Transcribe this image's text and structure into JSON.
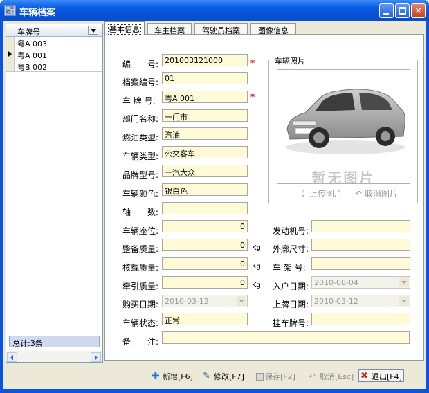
{
  "window": {
    "title": "车辆档案",
    "icon_text": "企业 解决",
    "controls": {
      "minimize": "minimize-icon",
      "maximize": "maximize-icon",
      "close": "×"
    }
  },
  "left_grid": {
    "column_header": "车牌号",
    "rows": [
      {
        "plate": "粤A 003",
        "current": false
      },
      {
        "plate": "粤A 001",
        "current": true
      },
      {
        "plate": "粤B 002",
        "current": false
      }
    ],
    "total": "总计:3条"
  },
  "tabs": [
    {
      "label": "基本信息",
      "active": true
    },
    {
      "label": "车主档案",
      "active": false
    },
    {
      "label": "驾驶员档案",
      "active": false
    },
    {
      "label": "图像信息",
      "active": false
    }
  ],
  "form": {
    "number": {
      "label": "编　　号:",
      "value": "201003121000",
      "required": "*"
    },
    "file_no": {
      "label": "档案编号:",
      "value": "01"
    },
    "plate": {
      "label": "车 牌 号:",
      "value": "粤A 001",
      "required": "*"
    },
    "department": {
      "label": "部门名称:",
      "value": "一门市"
    },
    "fuel_type": {
      "label": "燃油类型:",
      "value": "汽油"
    },
    "vehicle_type": {
      "label": "车辆类型:",
      "value": "公交客车"
    },
    "brand_model": {
      "label": "品牌型号:",
      "value": "一汽大众"
    },
    "color": {
      "label": "车辆颜色:",
      "value": "银白色"
    },
    "axle_count": {
      "label": "轴　　数:",
      "value": ""
    },
    "seats": {
      "label": "车辆座位:",
      "value": "0"
    },
    "curb_weight": {
      "label": "整备质量:",
      "value": "0",
      "unit": "Kg"
    },
    "load_weight": {
      "label": "核载质量:",
      "value": "0",
      "unit": "Kg"
    },
    "traction_weight": {
      "label": "牵引质量:",
      "value": "0",
      "unit": "Kg"
    },
    "purchase_date": {
      "label": "购买日期:",
      "value": "2010-03-12"
    },
    "status": {
      "label": "车辆状态:",
      "value": "正常"
    },
    "remarks": {
      "label": "备　　注:",
      "value": ""
    },
    "engine_no": {
      "label": "发动机号:",
      "value": ""
    },
    "dimensions": {
      "label": "外廓尺寸:",
      "value": ""
    },
    "frame_no": {
      "label": "车 架 号:",
      "value": ""
    },
    "entry_date": {
      "label": "入户日期:",
      "value": "2010-08-04"
    },
    "plate_date": {
      "label": "上牌日期:",
      "value": "2010-03-12"
    },
    "trailer_plate": {
      "label": "挂车牌号:",
      "value": ""
    }
  },
  "photo": {
    "legend": "车辆照片",
    "placeholder_text": "暂无图片",
    "upload_label": "上传图片",
    "cancel_label": "取消图片"
  },
  "toolbar": {
    "add": "新增[F6]",
    "edit": "修改[F7]",
    "save": "保存[F2]",
    "cancel": "取消[Esc]",
    "exit": "退出[F4]"
  },
  "colors": {
    "field_bg": "#fffbd8",
    "title_bar": "#0b5ee6",
    "required": "#d40000"
  }
}
